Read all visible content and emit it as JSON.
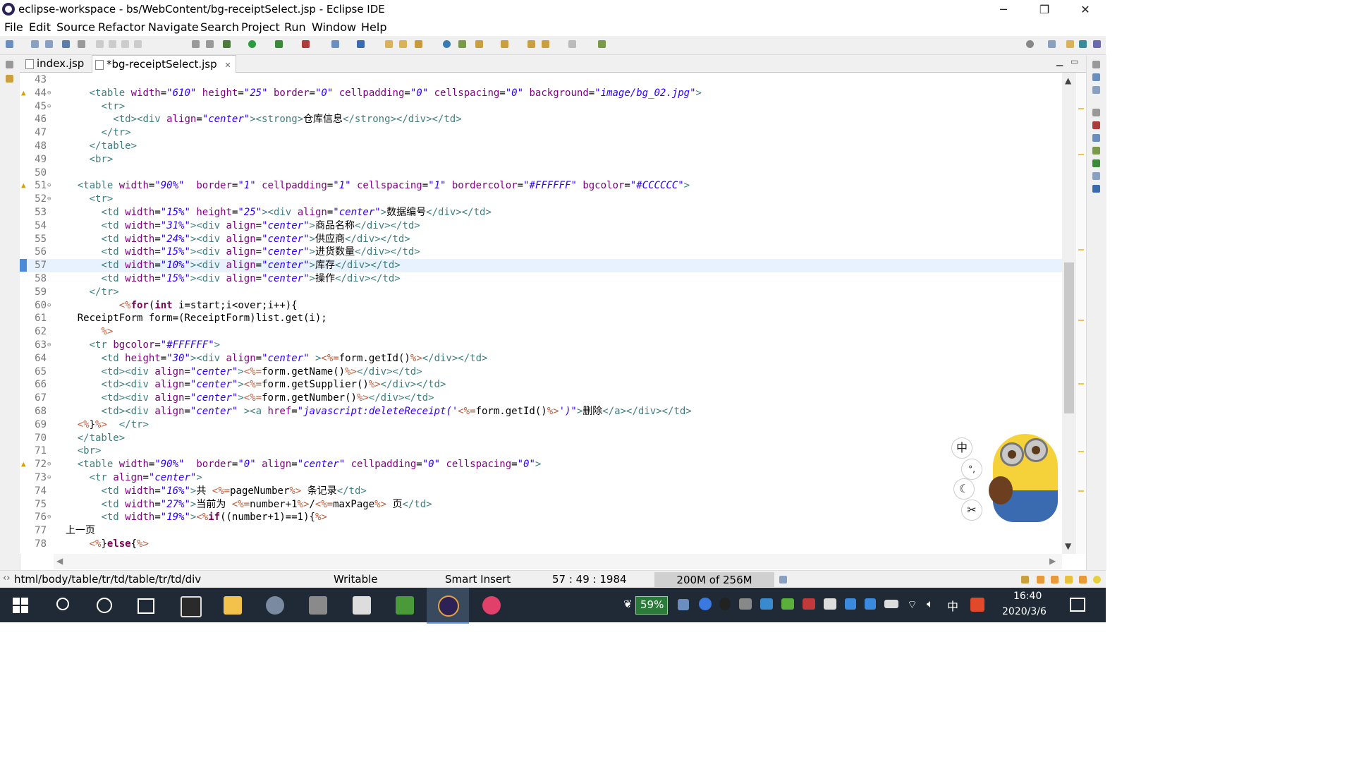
{
  "window": {
    "title": "eclipse-workspace - bs/WebContent/bg-receiptSelect.jsp - Eclipse IDE",
    "minimize_label": "─",
    "restore_label": "❐",
    "close_label": "✕"
  },
  "menu": [
    "File",
    "Edit",
    "Source",
    "Refactor",
    "Navigate",
    "Search",
    "Project",
    "Run",
    "Window",
    "Help"
  ],
  "tabs": [
    {
      "label": "index.jsp",
      "active": false
    },
    {
      "label": "*bg-receiptSelect.jsp",
      "active": true
    }
  ],
  "tab_close": "✕",
  "editor": {
    "current_line": 57,
    "lines": [
      {
        "n": "43",
        "html": ""
      },
      {
        "n": "44",
        "fold": true,
        "warn": true,
        "html": "      <span class='t'>&lt;table</span> <span class='a'>width</span>=<span class='s'>\"610\"</span> <span class='a'>height</span>=<span class='s'>\"25\"</span> <span class='a'>border</span>=<span class='s'>\"0\"</span> <span class='a'>cellpadding</span>=<span class='s'>\"0\"</span> <span class='a'>cellspacing</span>=<span class='s'>\"0\"</span> <span class='a'>background</span>=<span class='s'>\"image/bg_02.jpg\"</span><span class='t'>&gt;</span>"
      },
      {
        "n": "45",
        "fold": true,
        "html": "        <span class='t'>&lt;tr&gt;</span>"
      },
      {
        "n": "46",
        "html": "          <span class='t'>&lt;td&gt;&lt;div</span> <span class='a'>align</span>=<span class='s'>\"center\"</span><span class='t'>&gt;&lt;strong&gt;</span><span class='n'>仓库信息</span><span class='t'>&lt;/strong&gt;&lt;/div&gt;&lt;/td&gt;</span>"
      },
      {
        "n": "47",
        "html": "        <span class='t'>&lt;/tr&gt;</span>"
      },
      {
        "n": "48",
        "html": "      <span class='t'>&lt;/table&gt;</span>"
      },
      {
        "n": "49",
        "html": "      <span class='t'>&lt;br&gt;</span>"
      },
      {
        "n": "50",
        "html": ""
      },
      {
        "n": "51",
        "fold": true,
        "warn": true,
        "html": "    <span class='t'>&lt;table</span> <span class='a'>width</span>=<span class='s'>\"90%\"</span>  <span class='a'>border</span>=<span class='s'>\"1\"</span> <span class='a'>cellpadding</span>=<span class='s'>\"1\"</span> <span class='a'>cellspacing</span>=<span class='s'>\"1\"</span> <span class='a'>bordercolor</span>=<span class='s'>\"#FFFFFF\"</span> <span class='a'>bgcolor</span>=<span class='s'>\"#CCCCCC\"</span><span class='t'>&gt;</span>"
      },
      {
        "n": "52",
        "fold": true,
        "html": "      <span class='t'>&lt;tr&gt;</span>"
      },
      {
        "n": "53",
        "html": "        <span class='t'>&lt;td</span> <span class='a'>width</span>=<span class='s'>\"15%\"</span> <span class='a'>height</span>=<span class='s'>\"25\"</span><span class='t'>&gt;&lt;div</span> <span class='a'>align</span>=<span class='s'>\"center\"</span><span class='t'>&gt;</span><span class='n'>数据编号</span><span class='t'>&lt;/div&gt;&lt;/td&gt;</span>"
      },
      {
        "n": "54",
        "html": "        <span class='t'>&lt;td</span> <span class='a'>width</span>=<span class='s'>\"31%\"</span><span class='t'>&gt;&lt;div</span> <span class='a'>align</span>=<span class='s'>\"center\"</span><span class='t'>&gt;</span><span class='n'>商品名称</span><span class='t'>&lt;/div&gt;&lt;/td&gt;</span>"
      },
      {
        "n": "55",
        "html": "        <span class='t'>&lt;td</span> <span class='a'>width</span>=<span class='s'>\"24%\"</span><span class='t'>&gt;&lt;div</span> <span class='a'>align</span>=<span class='s'>\"center\"</span><span class='t'>&gt;</span><span class='n'>供应商</span><span class='t'>&lt;/div&gt;&lt;/td&gt;</span>"
      },
      {
        "n": "56",
        "html": "        <span class='t'>&lt;td</span> <span class='a'>width</span>=<span class='s'>\"15%\"</span><span class='t'>&gt;&lt;div</span> <span class='a'>align</span>=<span class='s'>\"center\"</span><span class='t'>&gt;</span><span class='n'>进货数量</span><span class='t'>&lt;/div&gt;&lt;/td&gt;</span>"
      },
      {
        "n": "57",
        "cur": true,
        "html": "        <span class='t'>&lt;td</span> <span class='a'>width</span>=<span class='s'>\"10%\"</span><span class='t'>&gt;&lt;div</span> <span class='a'>align</span>=<span class='s'>\"center\"</span><span class='t'>&gt;</span><span class='n'>库存</span><span class='t'>&lt;/div&gt;&lt;/td&gt;</span>"
      },
      {
        "n": "58",
        "html": "        <span class='t'>&lt;td</span> <span class='a'>width</span>=<span class='s'>\"15%\"</span><span class='t'>&gt;&lt;div</span> <span class='a'>align</span>=<span class='s'>\"center\"</span><span class='t'>&gt;</span><span class='n'>操作</span><span class='t'>&lt;/div&gt;&lt;/td&gt;</span>"
      },
      {
        "n": "59",
        "html": "      <span class='t'>&lt;/tr&gt;</span>"
      },
      {
        "n": "60",
        "fold": true,
        "html": "           <span class='j'>&lt;%</span><span class='k'>for</span>(<span class='k'>int</span> i=start;i&lt;over;i++){"
      },
      {
        "n": "61",
        "html": "    ReceiptForm form=(ReceiptForm)list.get(i);"
      },
      {
        "n": "62",
        "html": "        <span class='j'>%&gt;</span>"
      },
      {
        "n": "63",
        "fold": true,
        "html": "      <span class='t'>&lt;tr</span> <span class='a'>bgcolor</span>=<span class='s'>\"#FFFFFF\"</span><span class='t'>&gt;</span>"
      },
      {
        "n": "64",
        "html": "        <span class='t'>&lt;td</span> <span class='a'>height</span>=<span class='s'>\"30\"</span><span class='t'>&gt;&lt;div</span> <span class='a'>align</span>=<span class='s'>\"center\"</span> <span class='t'>&gt;</span><span class='j'>&lt;%=</span>form.getId()<span class='j'>%&gt;</span><span class='t'>&lt;/div&gt;&lt;/td&gt;</span>"
      },
      {
        "n": "65",
        "html": "        <span class='t'>&lt;td&gt;&lt;div</span> <span class='a'>align</span>=<span class='s'>\"center\"</span><span class='t'>&gt;</span><span class='j'>&lt;%=</span>form.getName()<span class='j'>%&gt;</span><span class='t'>&lt;/div&gt;&lt;/td&gt;</span>"
      },
      {
        "n": "66",
        "html": "        <span class='t'>&lt;td&gt;&lt;div</span> <span class='a'>align</span>=<span class='s'>\"center\"</span><span class='t'>&gt;</span><span class='j'>&lt;%=</span>form.getSupplier()<span class='j'>%&gt;</span><span class='t'>&lt;/div&gt;&lt;/td&gt;</span>"
      },
      {
        "n": "67",
        "html": "        <span class='t'>&lt;td&gt;&lt;div</span> <span class='a'>align</span>=<span class='s'>\"center\"</span><span class='t'>&gt;</span><span class='j'>&lt;%=</span>form.getNumber()<span class='j'>%&gt;</span><span class='t'>&lt;/div&gt;&lt;/td&gt;</span>"
      },
      {
        "n": "68",
        "html": "        <span class='t'>&lt;td&gt;&lt;div</span> <span class='a'>align</span>=<span class='s'>\"center\"</span> <span class='t'>&gt;&lt;a</span> <span class='a'>href</span>=<span class='s'>\"javascript:deleteReceipt('</span><span class='j'>&lt;%=</span>form.getId()<span class='j'>%&gt;</span><span class='s'>')\"</span><span class='t'>&gt;</span><span class='n'>删除</span><span class='t'>&lt;/a&gt;&lt;/div&gt;&lt;/td&gt;</span>"
      },
      {
        "n": "69",
        "html": "    <span class='j'>&lt;%</span>}<span class='j'>%&gt;</span>  <span class='t'>&lt;/tr&gt;</span>"
      },
      {
        "n": "70",
        "html": "    <span class='t'>&lt;/table&gt;</span>"
      },
      {
        "n": "71",
        "html": "    <span class='t'>&lt;br&gt;</span>"
      },
      {
        "n": "72",
        "fold": true,
        "warn": true,
        "html": "    <span class='t'>&lt;table</span> <span class='a'>width</span>=<span class='s'>\"90%\"</span>  <span class='a'>border</span>=<span class='s'>\"0\"</span> <span class='a'>align</span>=<span class='s'>\"center\"</span> <span class='a'>cellpadding</span>=<span class='s'>\"0\"</span> <span class='a'>cellspacing</span>=<span class='s'>\"0\"</span><span class='t'>&gt;</span>"
      },
      {
        "n": "73",
        "fold": true,
        "html": "      <span class='t'>&lt;tr</span> <span class='a'>align</span>=<span class='s'>\"center\"</span><span class='t'>&gt;</span>"
      },
      {
        "n": "74",
        "html": "        <span class='t'>&lt;td</span> <span class='a'>width</span>=<span class='s'>\"16%\"</span><span class='t'>&gt;</span><span class='n'>共 </span><span class='j'>&lt;%=</span>pageNumber<span class='j'>%&gt;</span> <span class='n'>条记录</span><span class='t'>&lt;/td&gt;</span>"
      },
      {
        "n": "75",
        "html": "        <span class='t'>&lt;td</span> <span class='a'>width</span>=<span class='s'>\"27%\"</span><span class='t'>&gt;</span><span class='n'>当前为 </span><span class='j'>&lt;%=</span>number+1<span class='j'>%&gt;</span>/<span class='j'>&lt;%=</span>maxPage<span class='j'>%&gt;</span> <span class='n'>页</span><span class='t'>&lt;/td&gt;</span>"
      },
      {
        "n": "76",
        "fold": true,
        "html": "        <span class='t'>&lt;td</span> <span class='a'>width</span>=<span class='s'>\"19%\"</span><span class='t'>&gt;</span><span class='j'>&lt;%</span><span class='k'>if</span>((number+1)==1){<span class='j'>%&gt;</span>"
      },
      {
        "n": "77",
        "html": "  <span class='n'>上一页</span>"
      },
      {
        "n": "78",
        "html": "      <span class='j'>&lt;%</span>}<span class='k'>else</span>{<span class='j'>%&gt;</span>"
      }
    ]
  },
  "status": {
    "breadcrumb": "html/body/table/tr/td/table/tr/td/div",
    "mode": "Writable",
    "insert": "Smart Insert",
    "position": "57 : 49 : 1984",
    "heap": "200M of 256M"
  },
  "ime": {
    "lang": "中",
    "punct": "°,",
    "moon": "☾",
    "skin": "✂"
  },
  "taskbar": {
    "battery": "59%",
    "ime_lang": "中",
    "time": "16:40",
    "date": "2020/3/6"
  }
}
